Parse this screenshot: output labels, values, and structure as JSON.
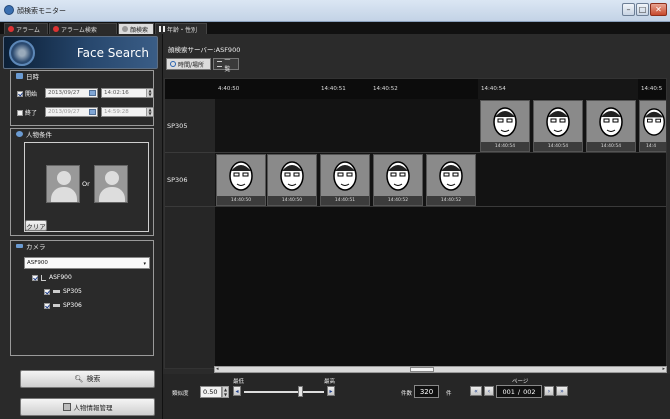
{
  "window": {
    "title": "顔検索モニター"
  },
  "tabs": [
    {
      "label": "アラーム"
    },
    {
      "label": "アラーム検索"
    },
    {
      "label": "顔検索"
    },
    {
      "label": "年齢・性別"
    }
  ],
  "logo": {
    "text": "Face Search"
  },
  "datetime": {
    "header": "日時",
    "start_label": "開始",
    "start_date": "2013/09/27",
    "start_time": "14:02:16",
    "end_label": "終了",
    "end_date": "2013/09/27",
    "end_time": "14:59:28"
  },
  "person": {
    "header": "人物条件",
    "or_label": "Or",
    "clear_button": "クリア"
  },
  "camera": {
    "header": "カメラ",
    "server_select": "ASF900",
    "tree": [
      {
        "label": "ASF900",
        "checked": true
      },
      {
        "label": "SP305",
        "checked": true
      },
      {
        "label": "SP306",
        "checked": true
      }
    ]
  },
  "actions": {
    "search_button": "検索",
    "manage_button": "人物情報管理"
  },
  "main": {
    "server_label": "顔検索サーバー:ASF900",
    "view_tabs": [
      {
        "label": "時間/場所"
      },
      {
        "label": "一覧"
      }
    ],
    "time_headers": [
      "4:40:50",
      "14:40:51",
      "14:40:52",
      "14:40:54",
      "14:40:5"
    ],
    "rows": [
      {
        "label": "SP305",
        "faces": [
          "14:40:54",
          "14:40:54",
          "14:40:54",
          "14:4"
        ]
      },
      {
        "label": "SP306",
        "faces": [
          "14:40:50",
          "14:40:50",
          "14:40:51",
          "14:40:52",
          "14:40:52"
        ]
      }
    ]
  },
  "footer": {
    "threshold_label": "類似度",
    "threshold_value": "0.50",
    "slider_low": "最低",
    "slider_high": "最高",
    "slider_level": 0.7,
    "count_label": "件数",
    "count_value": "320",
    "count_unit": "件",
    "page_label": "ページ",
    "page_current": "001",
    "page_sep": "/",
    "page_total": "002"
  },
  "colors": {
    "accent": "#6b9bd2",
    "alarm": "#dd3333"
  }
}
